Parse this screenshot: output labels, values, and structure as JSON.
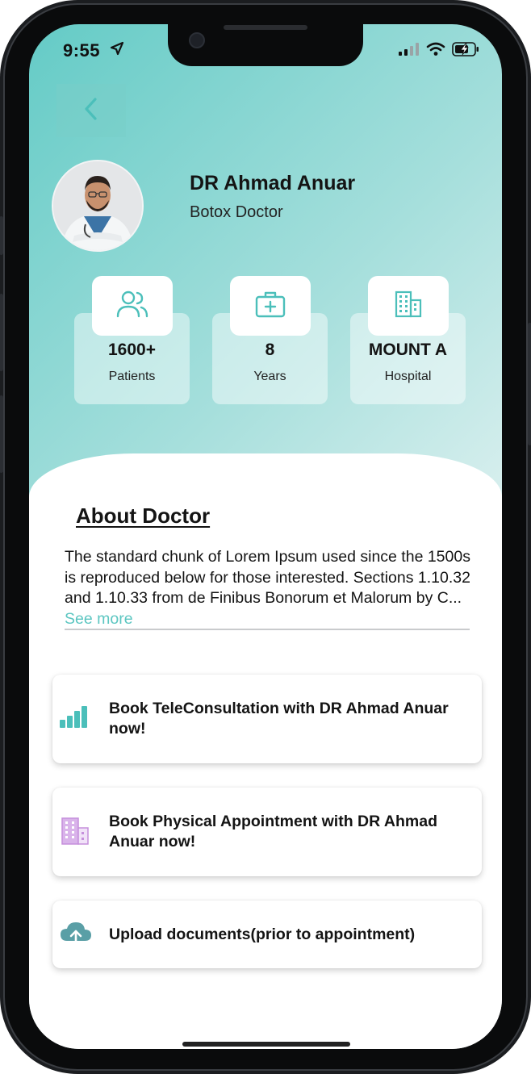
{
  "status_bar": {
    "time": "9:55",
    "location_icon": "location-arrow-icon",
    "signal_icon": "cellular-signal-icon",
    "wifi_icon": "wifi-icon",
    "battery_icon": "battery-charging-icon"
  },
  "header": {
    "back_icon": "chevron-left-icon"
  },
  "doctor": {
    "name": "DR Ahmad Anuar",
    "specialty": "Botox Doctor",
    "avatar_icon": "doctor-avatar"
  },
  "stats": [
    {
      "icon": "people-icon",
      "value": "1600+",
      "label": "Patients"
    },
    {
      "icon": "medical-kit-icon",
      "value": "8",
      "label": "Years"
    },
    {
      "icon": "hospital-building-icon",
      "value": "MOUNT A",
      "label": "Hospital"
    }
  ],
  "about": {
    "title": "About Doctor",
    "text": "The standard chunk of Lorem Ipsum used since the 1500s is reproduced below for those interested. Sections 1.10.32 and 1.10.33 from de Finibus Bonorum et Malorum by C...",
    "see_more": "See more"
  },
  "actions": [
    {
      "icon": "signal-bars-icon",
      "label": "Book TeleConsultation with DR Ahmad Anuar now!"
    },
    {
      "icon": "building-icon",
      "label": "Book Physical Appointment with DR Ahmad Anuar now!"
    },
    {
      "icon": "cloud-upload-icon",
      "label": "Upload documents(prior to appointment)"
    }
  ],
  "colors": {
    "accent": "#5cc6c1",
    "header_gradient_start": "#64cbc6",
    "header_gradient_end": "#eef7f7",
    "purple_accent": "#c58fdc"
  }
}
